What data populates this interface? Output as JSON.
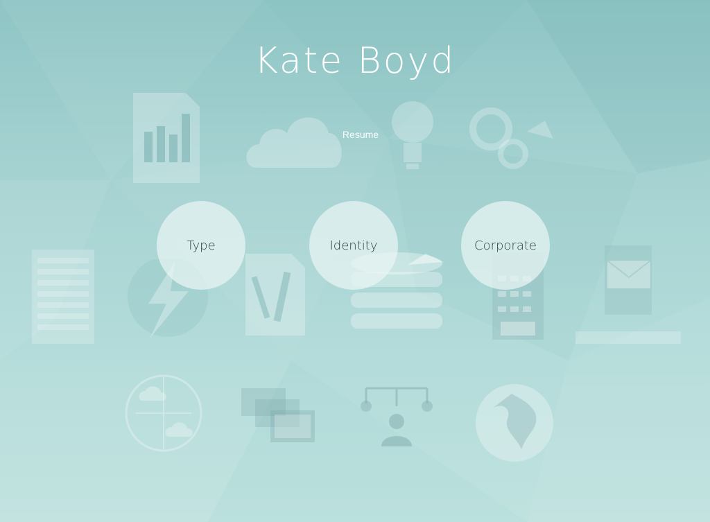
{
  "header": {
    "title": "Kate Boyd",
    "subtitle": "Resume"
  },
  "nav": {
    "items": [
      {
        "label": "Type"
      },
      {
        "label": "Identity"
      },
      {
        "label": "Corporate"
      }
    ]
  },
  "background": {
    "icons": [
      "bar-chart-document-icon",
      "cloud-icon",
      "lightbulb-icon",
      "gears-icon",
      "text-document-icon",
      "lightning-icon",
      "art-tools-icon",
      "database-icon",
      "pie-chart-icon",
      "office-building-icon",
      "envelope-icon",
      "cloud-network-icon",
      "stacked-windows-icon",
      "org-chart-icon",
      "globe-icon"
    ],
    "colors": {
      "top": "#8fc5c5",
      "bottom": "#bfe2df",
      "icon": "#ffffff"
    }
  }
}
